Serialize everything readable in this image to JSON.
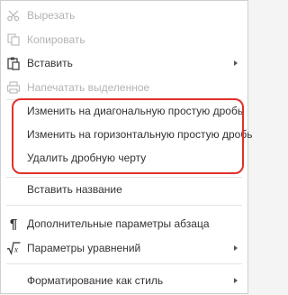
{
  "menu": {
    "items": {
      "cut": {
        "label": "Вырезать",
        "icon": "scissors-icon"
      },
      "copy": {
        "label": "Копировать",
        "icon": "copy-icon"
      },
      "paste": {
        "label": "Вставить",
        "icon": "paste-icon"
      },
      "print_selection": {
        "label": "Напечатать выделенное",
        "icon": "printer-icon"
      },
      "diagonal_fraction": {
        "label": "Изменить на диагональную простую дробь"
      },
      "horizontal_fraction": {
        "label": "Изменить на горизонтальную простую дробь"
      },
      "remove_fraction_bar": {
        "label": "Удалить дробную черту"
      },
      "insert_caption": {
        "label": "Вставить название"
      },
      "paragraph_settings": {
        "label": "Дополнительные параметры абзаца",
        "icon": "pilcrow-icon"
      },
      "equation_settings": {
        "label": "Параметры уравнений",
        "icon": "sqrt-icon"
      },
      "format_as_style": {
        "label": "Форматирование как стиль"
      }
    },
    "colors": {
      "highlight_border": "#e0312b",
      "disabled_text": "#b3b3b3"
    }
  }
}
